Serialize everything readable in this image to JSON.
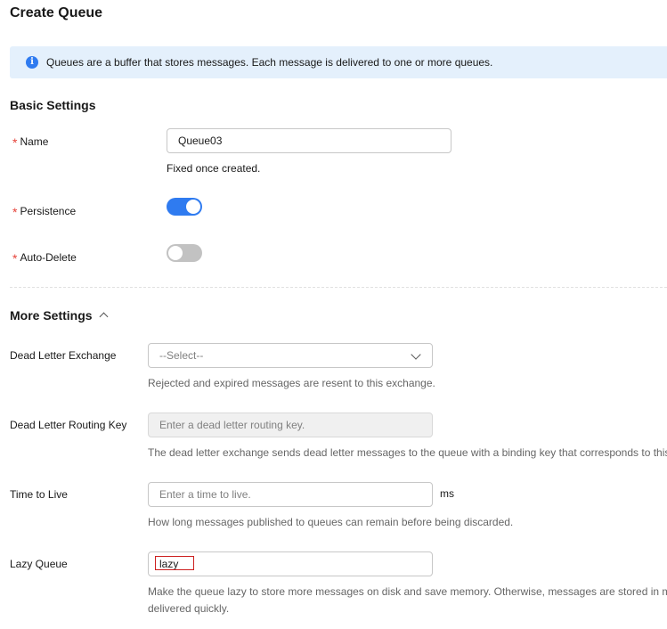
{
  "page": {
    "title": "Create Queue",
    "info": "Queues are a buffer that stores messages. Each message is delivered to one or more queues."
  },
  "basic": {
    "title": "Basic Settings",
    "required_mark": "*",
    "name_label": "Name",
    "name_value": "Queue03",
    "name_hint": "Fixed once created.",
    "persistence_label": "Persistence",
    "persistence_on": true,
    "auto_delete_label": "Auto-Delete",
    "auto_delete_on": false
  },
  "more": {
    "title": "More Settings",
    "dlx_label": "Dead Letter Exchange",
    "dlx_placeholder": "--Select--",
    "dlx_hint": "Rejected and expired messages are resent to this exchange.",
    "dlrk_label": "Dead Letter Routing Key",
    "dlrk_placeholder": "Enter a dead letter routing key.",
    "dlrk_hint": "The dead letter exchange sends dead letter messages to the queue with a binding key that corresponds to this",
    "ttl_label": "Time to Live",
    "ttl_placeholder": "Enter a time to live.",
    "ttl_unit": "ms",
    "ttl_hint": "How long messages published to queues can remain before being discarded.",
    "lazy_label": "Lazy Queue",
    "lazy_value": "lazy",
    "lazy_hint_1": "Make the queue lazy to store more messages on disk and save memory. Otherwise, messages are stored in m",
    "lazy_hint_2": "delivered quickly."
  },
  "colors": {
    "accent": "#2f7bf0",
    "required": "#e6433a",
    "banner_bg": "#e4f0fc",
    "highlight": "#cc1f1f"
  }
}
